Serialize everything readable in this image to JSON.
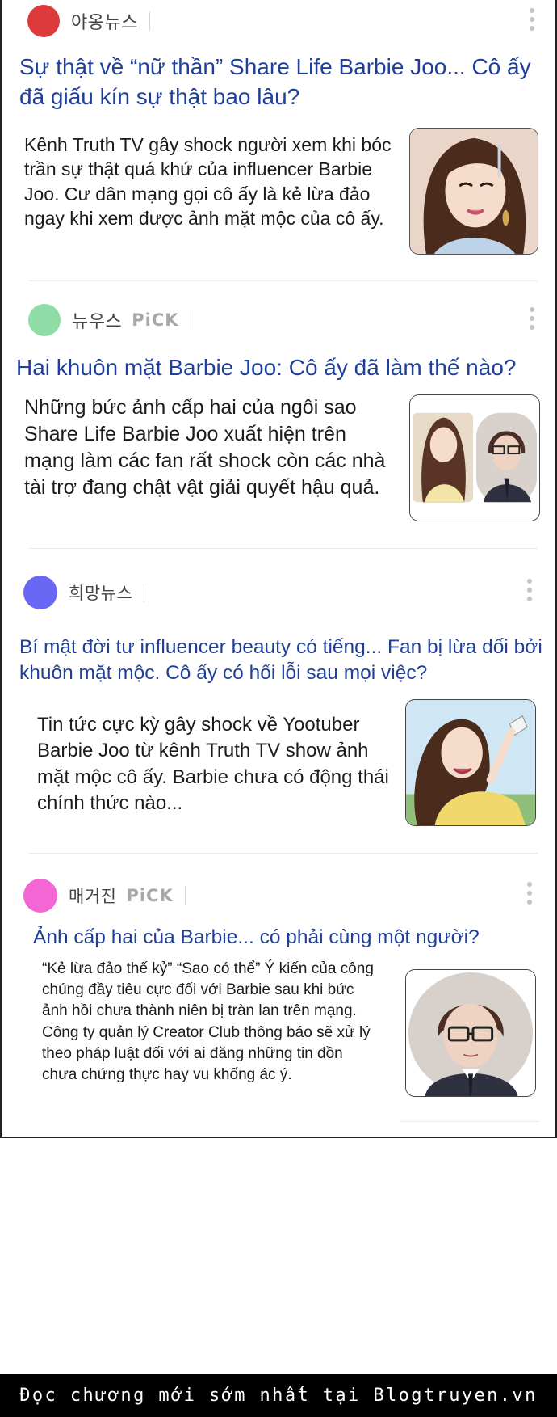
{
  "articles": [
    {
      "source": "야옹뉴스",
      "pick": "",
      "dot_color": "#dd3b3b",
      "title": "Sự thật về “nữ thần” Share Life Barbie Joo... Cô ấy đã giấu kín sự thật bao lâu?",
      "summary": "Kênh Truth TV gây shock người xem khi bóc trần sự thật quá khứ của influencer Barbie Joo. Cư dân mạng gọi cô ấy là kẻ lừa đảo ngay khi xem được ảnh mặt mộc của cô ấy."
    },
    {
      "source": "뉴우스",
      "pick": "PiCK",
      "dot_color": "#8fdca6",
      "title": "Hai khuôn mặt Barbie Joo: Cô ấy đã làm thế nào?",
      "summary": "Những bức ảnh cấp hai của ngôi sao Share Life Barbie Joo xuất hiện trên mạng làm các fan rất shock còn các nhà tài trợ đang chật vật giải quyết hậu quả."
    },
    {
      "source": "희망뉴스",
      "pick": "",
      "dot_color": "#6868f5",
      "title": "Bí mật đời tư influencer beauty có tiếng... Fan bị lừa dối bởi khuôn mặt mộc. Cô ấy có hối lỗi sau mọi việc?",
      "summary": "Tin tức cực kỳ gây shock về Yootuber Barbie Joo từ kênh Truth TV show ảnh mặt mộc cô ấy. Barbie chưa có động thái chính thức nào..."
    },
    {
      "source": "매거진",
      "pick": "PiCK",
      "dot_color": "#f466d4",
      "title": "Ảnh cấp hai của Barbie... có phải cùng một người?",
      "summary": "“Kẻ lừa đảo thế kỷ” “Sao có thể” Ý kiến của công chúng đầy tiêu cực đối với Barbie sau khi bức ảnh hồi chưa thành niên bị tràn lan trên mạng. Công ty quản lý Creator Club thông báo sẽ xử lý theo pháp luật đối với ai đăng những tin đồn chưa chứng thực hay vu khống ác ý."
    }
  ],
  "footer": {
    "watermark": "Đọc chương mới sớm nhất tại Blogtruyen.vn"
  },
  "icons": {
    "more": "more-vertical-icon"
  }
}
